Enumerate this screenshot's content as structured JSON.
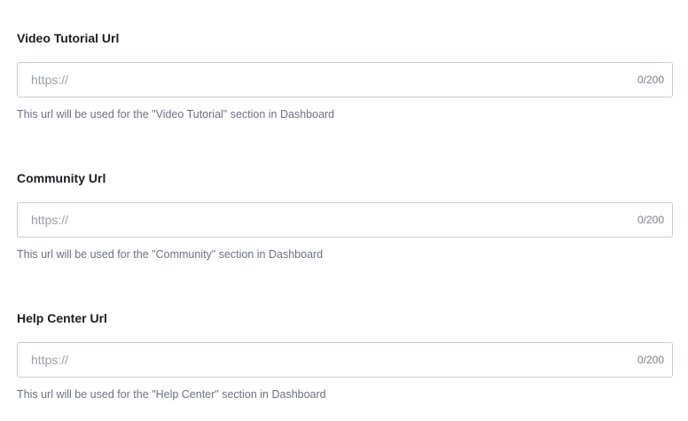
{
  "fields": [
    {
      "label": "Video Tutorial Url",
      "placeholder": "https://",
      "value": "",
      "counter": "0/200",
      "helper": "This url will be used for the \"Video Tutorial\" section in Dashboard"
    },
    {
      "label": "Community Url",
      "placeholder": "https://",
      "value": "",
      "counter": "0/200",
      "helper": "This url will be used for the \"Community\" section in Dashboard"
    },
    {
      "label": "Help Center Url",
      "placeholder": "https://",
      "value": "",
      "counter": "0/200",
      "helper": "This url will be used for the \"Help Center\" section in Dashboard"
    }
  ]
}
